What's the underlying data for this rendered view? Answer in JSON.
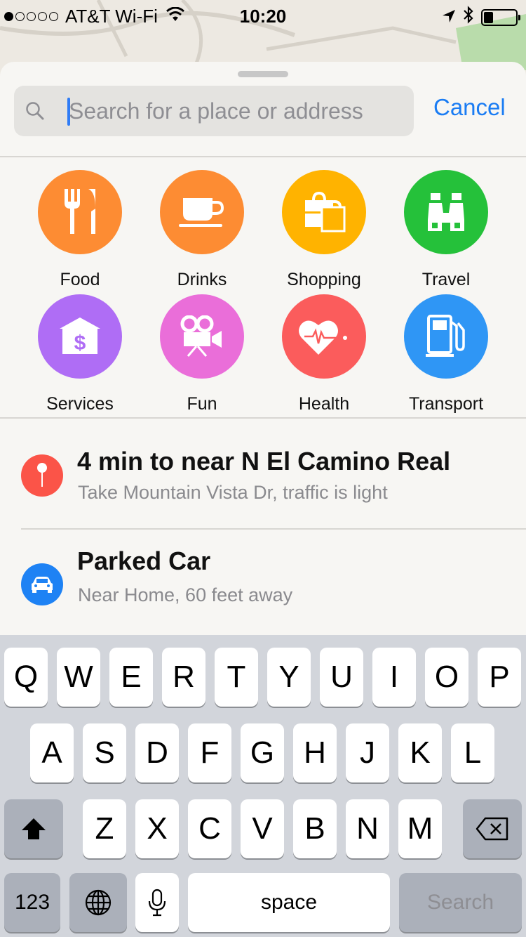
{
  "status_bar": {
    "carrier": "AT&T Wi-Fi",
    "time": "10:20",
    "signal_bars_filled": 1,
    "signal_bars_total": 5,
    "battery_level": 0.3
  },
  "search": {
    "placeholder": "Search for a place or address",
    "value": "",
    "cancel_label": "Cancel"
  },
  "categories": [
    {
      "label": "Food",
      "icon": "fork-knife-icon",
      "color": "#fd8c33"
    },
    {
      "label": "Drinks",
      "icon": "coffee-cup-icon",
      "color": "#fd8c33"
    },
    {
      "label": "Shopping",
      "icon": "shopping-bag-icon",
      "color": "#ffb300"
    },
    {
      "label": "Travel",
      "icon": "binoculars-icon",
      "color": "#25c13a"
    },
    {
      "label": "Services",
      "icon": "bank-icon",
      "color": "#af6df5"
    },
    {
      "label": "Fun",
      "icon": "movie-camera-icon",
      "color": "#ea6ed9"
    },
    {
      "label": "Health",
      "icon": "heart-pulse-icon",
      "color": "#fb5c5c"
    },
    {
      "label": "Transport",
      "icon": "fuel-pump-icon",
      "color": "#2f96f5"
    }
  ],
  "suggestions": [
    {
      "title": "4 min to near N El Camino Real",
      "subtitle": "Take Mountain Vista Dr, traffic is light",
      "icon": "pin-icon",
      "color": "#fb5448"
    },
    {
      "title": "Parked Car",
      "subtitle": "Near Home, 60 feet away",
      "icon": "car-icon",
      "color": "#1e82f4"
    }
  ],
  "keyboard": {
    "row1": [
      "Q",
      "W",
      "E",
      "R",
      "T",
      "Y",
      "U",
      "I",
      "O",
      "P"
    ],
    "row2": [
      "A",
      "S",
      "D",
      "F",
      "G",
      "H",
      "J",
      "K",
      "L"
    ],
    "row3": [
      "Z",
      "X",
      "C",
      "V",
      "B",
      "N",
      "M"
    ],
    "numbers_label": "123",
    "space_label": "space",
    "search_label": "Search"
  }
}
